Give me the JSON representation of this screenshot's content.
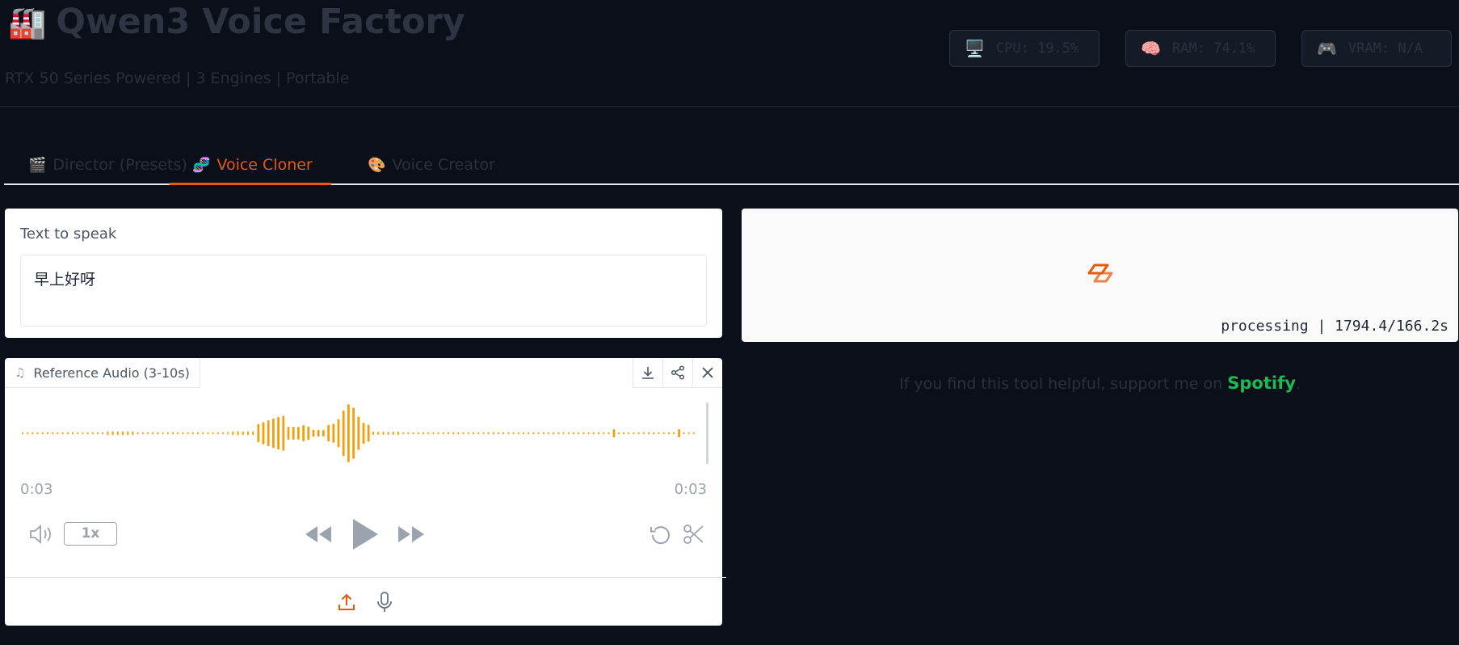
{
  "header": {
    "title_emoji": "🏭",
    "title": "Qwen3 Voice Factory",
    "subtitle": "RTX 50 Series Powered | 3 Engines | Portable",
    "stats": [
      {
        "icon": "🖥️",
        "label": "CPU: 19.5%"
      },
      {
        "icon": "🧠",
        "label": "RAM: 74.1%"
      },
      {
        "icon": "🎮",
        "label": "VRAM: N/A"
      }
    ]
  },
  "tabs": [
    {
      "icon": "🎬",
      "label": "Director (Presets)",
      "active": false
    },
    {
      "icon": "🧬",
      "label": "Voice Cloner",
      "active": true
    },
    {
      "icon": "🎨",
      "label": "Voice Creator",
      "active": false
    }
  ],
  "text_input": {
    "label": "Text to speak",
    "value": "早上好呀"
  },
  "audio": {
    "label": "Reference Audio (3-10s)",
    "time_current": "0:03",
    "time_total": "0:03",
    "speed": "1x",
    "waveform_color": "#f59e0b"
  },
  "output": {
    "status": "processing | 1794.4/166.2s",
    "accent": "#ea580c"
  },
  "support": {
    "prefix": "If you find this tool helpful, support me on ",
    "link_text": "Spotify",
    "suffix": ".",
    "link_color": "#1db954"
  }
}
